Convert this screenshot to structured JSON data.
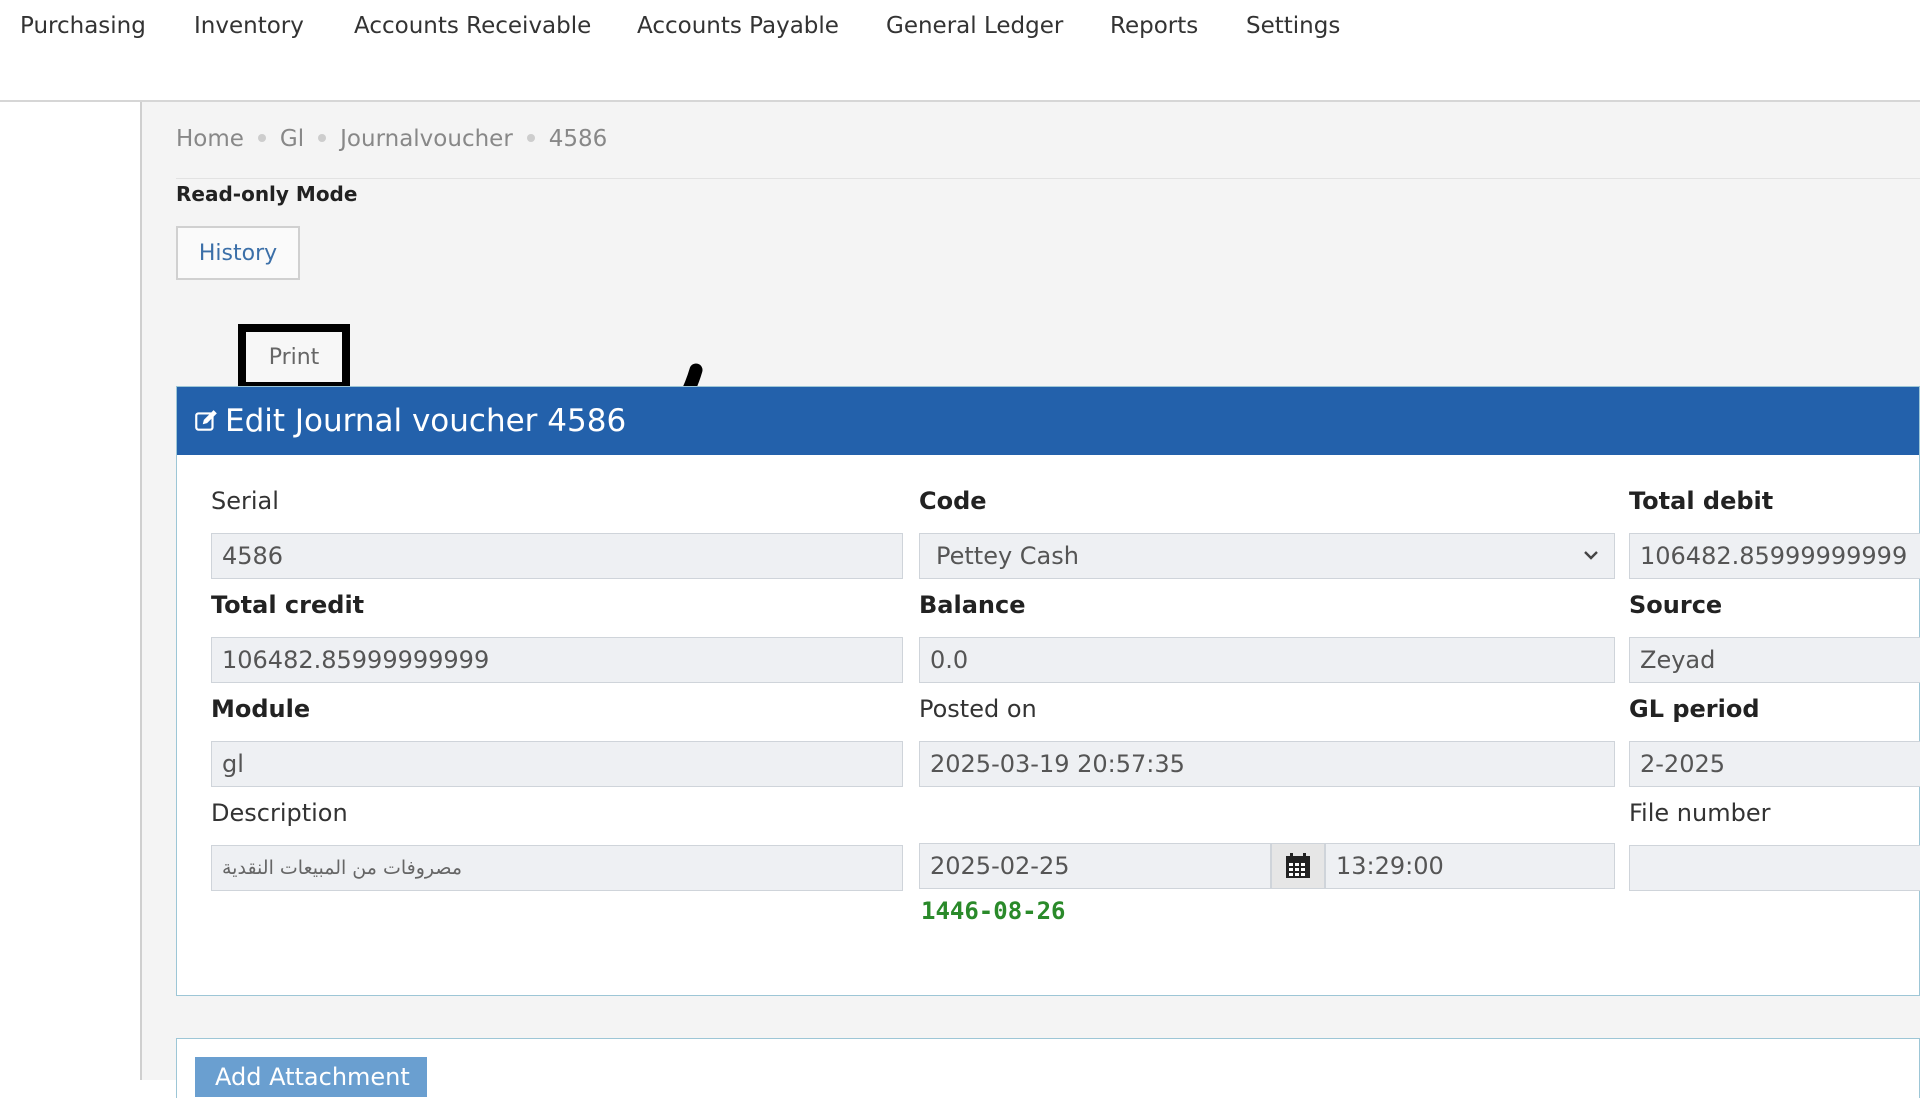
{
  "nav": {
    "items": [
      "Purchasing",
      "Inventory",
      "Accounts Receivable",
      "Accounts Payable",
      "General Ledger",
      "Reports",
      "Settings"
    ]
  },
  "breadcrumb": [
    "Home",
    "Gl",
    "Journalvoucher",
    "4586"
  ],
  "mode": "Read-only Mode",
  "actions": {
    "history": "History",
    "print": "Print"
  },
  "panel": {
    "title": "Edit Journal voucher 4586",
    "fields": {
      "serial": {
        "label": "Serial",
        "value": "4586"
      },
      "code": {
        "label": "Code",
        "value": "Pettey Cash"
      },
      "total_debit": {
        "label": "Total debit",
        "value": "106482.85999999999"
      },
      "total_credit": {
        "label": "Total credit",
        "value": "106482.85999999999"
      },
      "balance": {
        "label": "Balance",
        "value": "0.0"
      },
      "source": {
        "label": "Source",
        "value": "Zeyad"
      },
      "module": {
        "label": "Module",
        "value": "gl"
      },
      "posted_on": {
        "label": "Posted on",
        "value": "2025-03-19 20:57:35"
      },
      "gl_period": {
        "label": "GL period",
        "value": "2-2025"
      },
      "description": {
        "label": "Description",
        "value": "مصروفات من المبيعات النقدية"
      },
      "date": {
        "value": "2025-02-25",
        "time": "13:29:00",
        "hijri": "1446-08-26"
      },
      "file_number": {
        "label": "File number",
        "value": ""
      }
    }
  },
  "attachments": {
    "button": "Add Attachment"
  },
  "colors": {
    "header": "#2361ab",
    "hijri": "#2a8a2a",
    "link": "#3b6fa8"
  },
  "icons": [
    "edit-icon",
    "calendar-icon",
    "chevron-down-icon",
    "arrow-annotation-icon"
  ]
}
